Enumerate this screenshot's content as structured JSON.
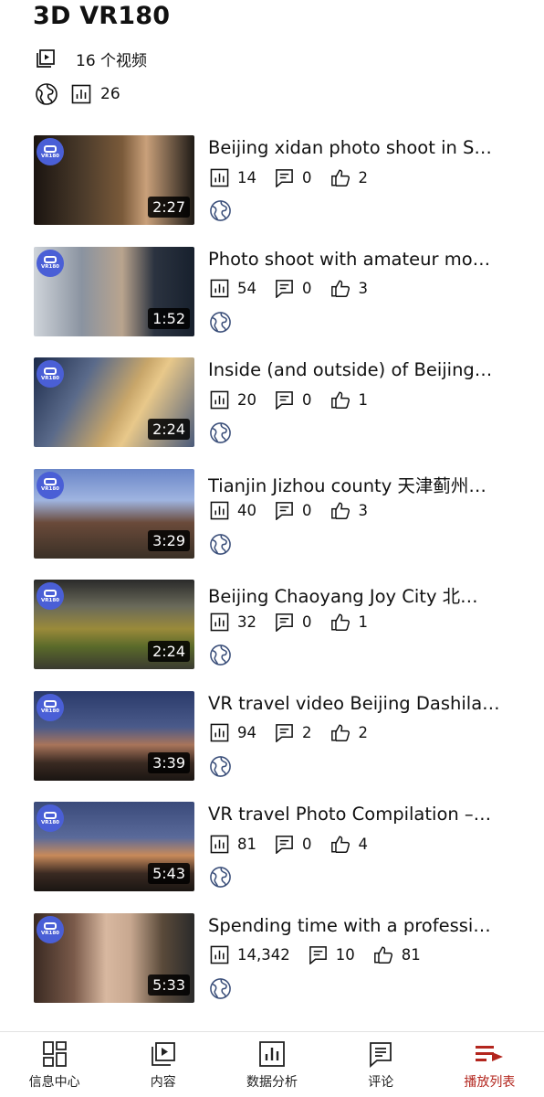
{
  "playlist": {
    "title": "3D VR180",
    "video_count": "16 个视频",
    "views": "26",
    "visibility_icon": "globe-icon"
  },
  "videos": [
    {
      "title": "Beijing xidan photo shoot in S…",
      "duration": "2:27",
      "views": "14",
      "comments": "0",
      "likes": "2"
    },
    {
      "title": "Photo shoot with amateur mo…",
      "duration": "1:52",
      "views": "54",
      "comments": "0",
      "likes": "3"
    },
    {
      "title": "Inside (and outside) of Beijing…",
      "duration": "2:24",
      "views": "20",
      "comments": "0",
      "likes": "1"
    },
    {
      "title": "Tianjin Jizhou county 天津蓟州…",
      "duration": "3:29",
      "views": "40",
      "comments": "0",
      "likes": "3"
    },
    {
      "title": "Beijing Chaoyang Joy City 北…",
      "duration": "2:24",
      "views": "32",
      "comments": "0",
      "likes": "1"
    },
    {
      "title": "VR travel video Beijing Dashila…",
      "duration": "3:39",
      "views": "94",
      "comments": "2",
      "likes": "2"
    },
    {
      "title": "VR travel Photo Compilation –…",
      "duration": "5:43",
      "views": "81",
      "comments": "0",
      "likes": "4"
    },
    {
      "title": "Spending time with a professi…",
      "duration": "5:33",
      "views": "14,342",
      "comments": "10",
      "likes": "81"
    }
  ],
  "badge_label": "VR180",
  "nav": {
    "items": [
      {
        "label": "信息中心",
        "icon": "dashboard-icon"
      },
      {
        "label": "内容",
        "icon": "content-icon"
      },
      {
        "label": "数据分析",
        "icon": "analytics-icon"
      },
      {
        "label": "评论",
        "icon": "comments-icon"
      },
      {
        "label": "播放列表",
        "icon": "playlist-icon"
      }
    ],
    "active_index": 4,
    "active_color": "#b3261e"
  },
  "colors": {
    "badge": "#4a5fd6",
    "text": "#111111",
    "globe": "#3b4f7a"
  }
}
